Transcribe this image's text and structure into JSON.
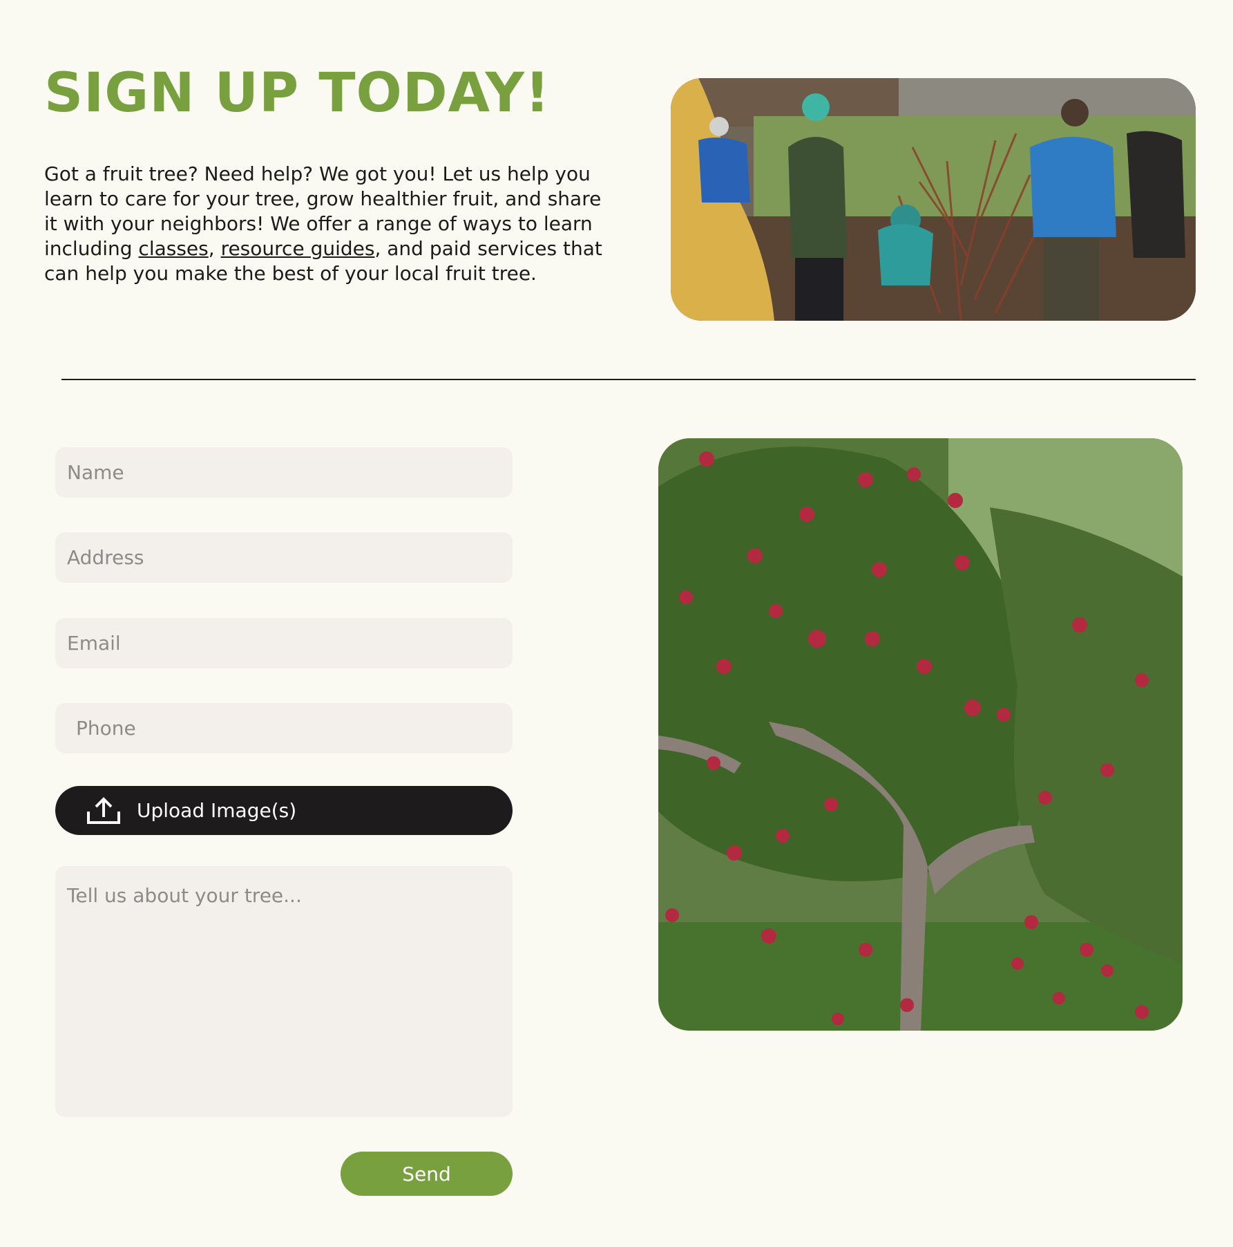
{
  "heading": "SIGN UP TODAY!",
  "intro": {
    "text_before": "Got a fruit tree? Need help? We got you! Let us help you learn to care for your tree, grow healthier fruit, and share it with your neighbors! We offer a range of ways to learn including ",
    "link_classes": "classes",
    "separator": ", ",
    "link_guides": "resource guides",
    "text_after": ", and paid services that can help you make the best of your local fruit tree."
  },
  "images": {
    "top": "people pruning fruit tree in orchard",
    "bottom": "apple tree with red apples"
  },
  "form": {
    "name_placeholder": "Name",
    "address_placeholder": "Address",
    "email_placeholder": "Email",
    "phone_placeholder": "Phone",
    "upload_label": "Upload Image(s)",
    "upload_icon": "upload-icon",
    "message_placeholder": "Tell us about your tree...",
    "send_label": "Send"
  },
  "colors": {
    "accent_green": "#78a03f",
    "background": "#fbfaf2",
    "field_bg": "#f3efea",
    "dark_button": "#1e1b1c",
    "text": "#1c1a1b"
  }
}
